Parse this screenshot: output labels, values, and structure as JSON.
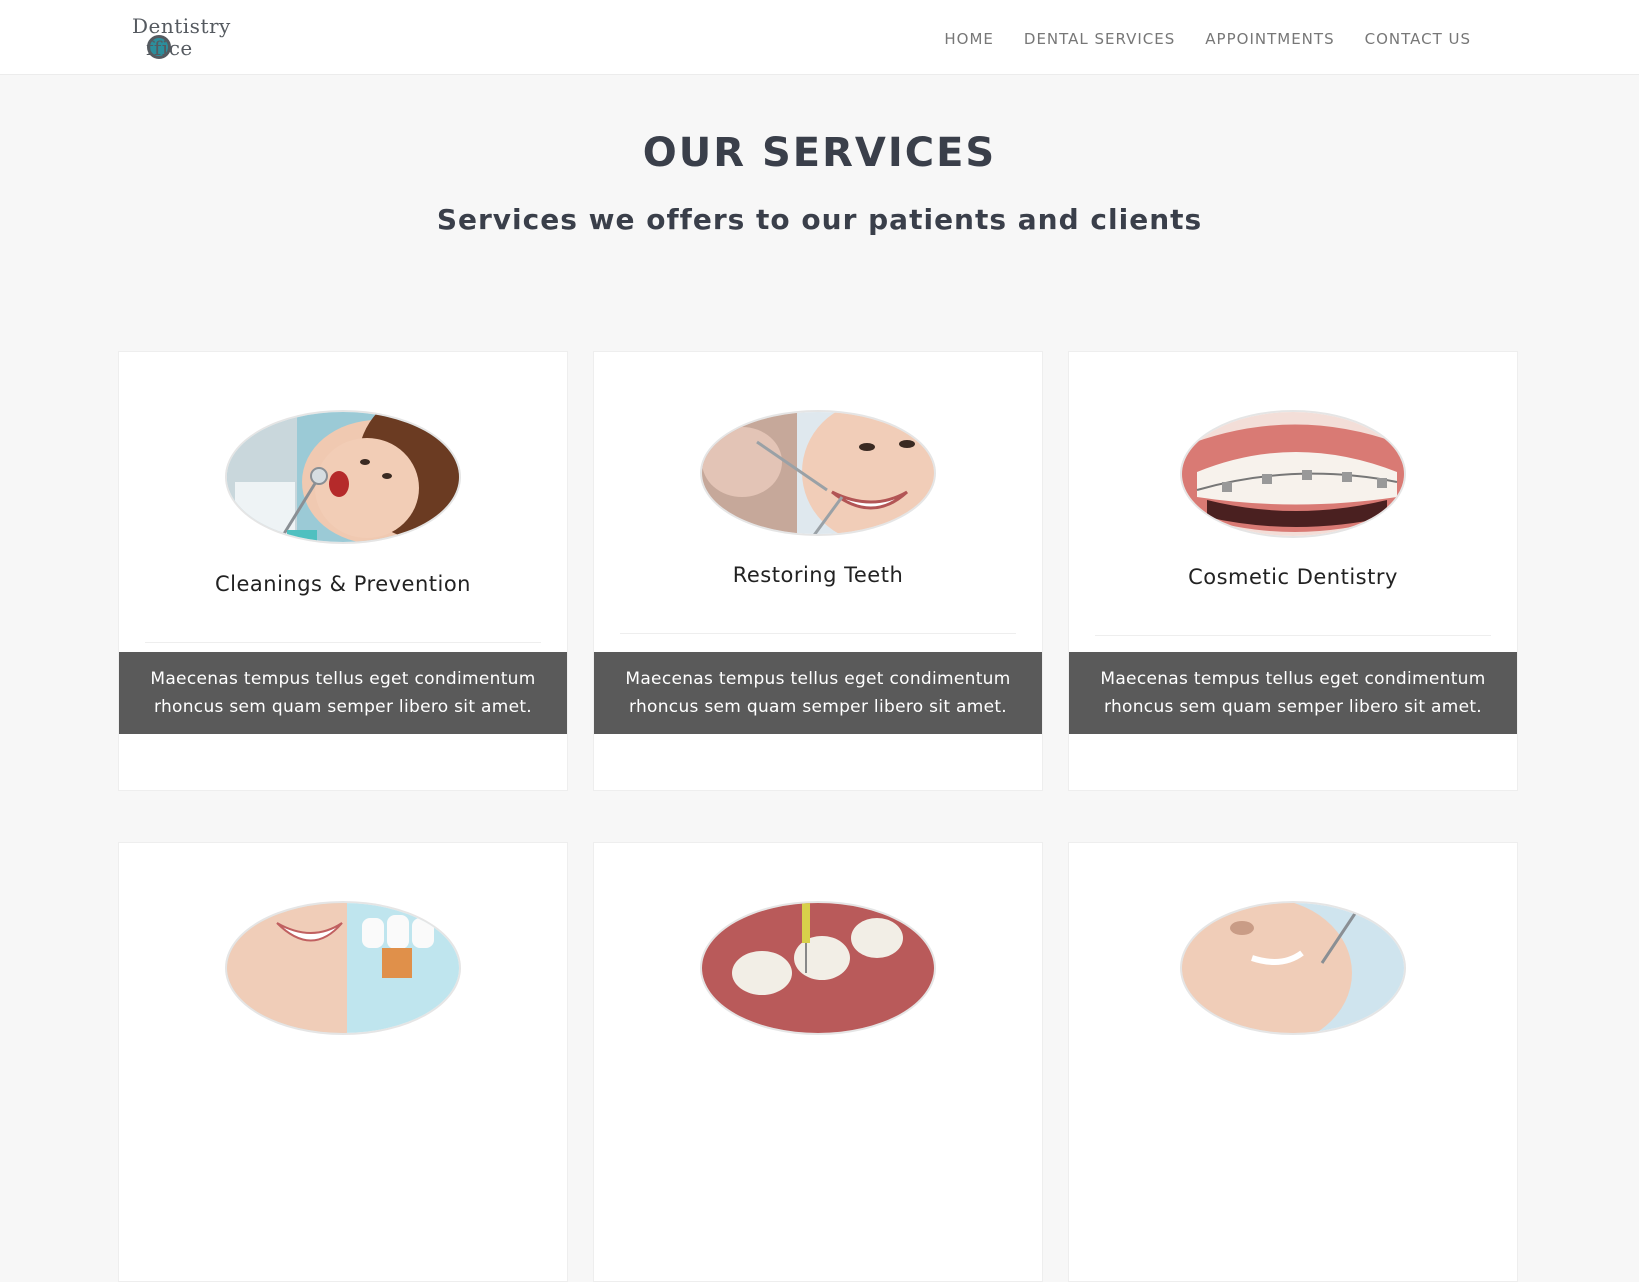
{
  "logo": {
    "line1": "Dentistry",
    "line2": "ffice",
    "alt": "Dentistry Office"
  },
  "nav": {
    "items": [
      "HOME",
      "DENTAL SERVICES",
      "APPOINTMENTS",
      "CONTACT US"
    ]
  },
  "hero": {
    "title": "OUR SERVICES",
    "subtitle": "Services we offers to our patients and clients"
  },
  "services": [
    {
      "title": "Cleanings & Prevention",
      "desc_line1": "Maecenas tempus tellus eget condimentum",
      "desc_line2": "rhoncus sem quam semper libero sit amet."
    },
    {
      "title": "Restoring Teeth",
      "desc_line1": "Maecenas tempus tellus eget condimentum",
      "desc_line2": "rhoncus sem quam semper libero sit amet."
    },
    {
      "title": "Cosmetic Dentistry",
      "desc_line1": "Maecenas tempus tellus eget condimentum",
      "desc_line2": "rhoncus sem quam semper libero sit amet."
    }
  ],
  "colors": {
    "page_bg": "#f7f7f7",
    "nav_bg": "#ffffff",
    "desc_band": "#5a5a5a",
    "accent": "#2b8e9c"
  }
}
